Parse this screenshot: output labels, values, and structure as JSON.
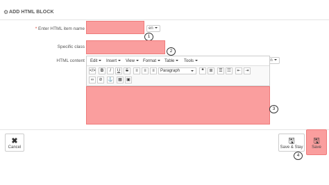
{
  "header": {
    "title": "ADD HTML BLOCK",
    "icon": "gears-icon"
  },
  "form": {
    "item_name": {
      "label": "Enter HTML item name",
      "required_mark": "*",
      "value": "",
      "lang": "en"
    },
    "specific_class": {
      "label": "Specific class",
      "value": ""
    },
    "html_content": {
      "label": "HTML content",
      "lang": "en",
      "value": ""
    }
  },
  "editor": {
    "menus": [
      "Edit",
      "Insert",
      "View",
      "Format",
      "Table",
      "Tools"
    ],
    "format_select": "Paragraph"
  },
  "annotations": [
    "1",
    "2",
    "3",
    "4"
  ],
  "footer": {
    "cancel_label": "Cancel",
    "save_stay_label": "Save & Stay",
    "save_label": "Save"
  },
  "colors": {
    "highlight": "#fa9e9e",
    "highlight_border": "#ef7a7a"
  }
}
